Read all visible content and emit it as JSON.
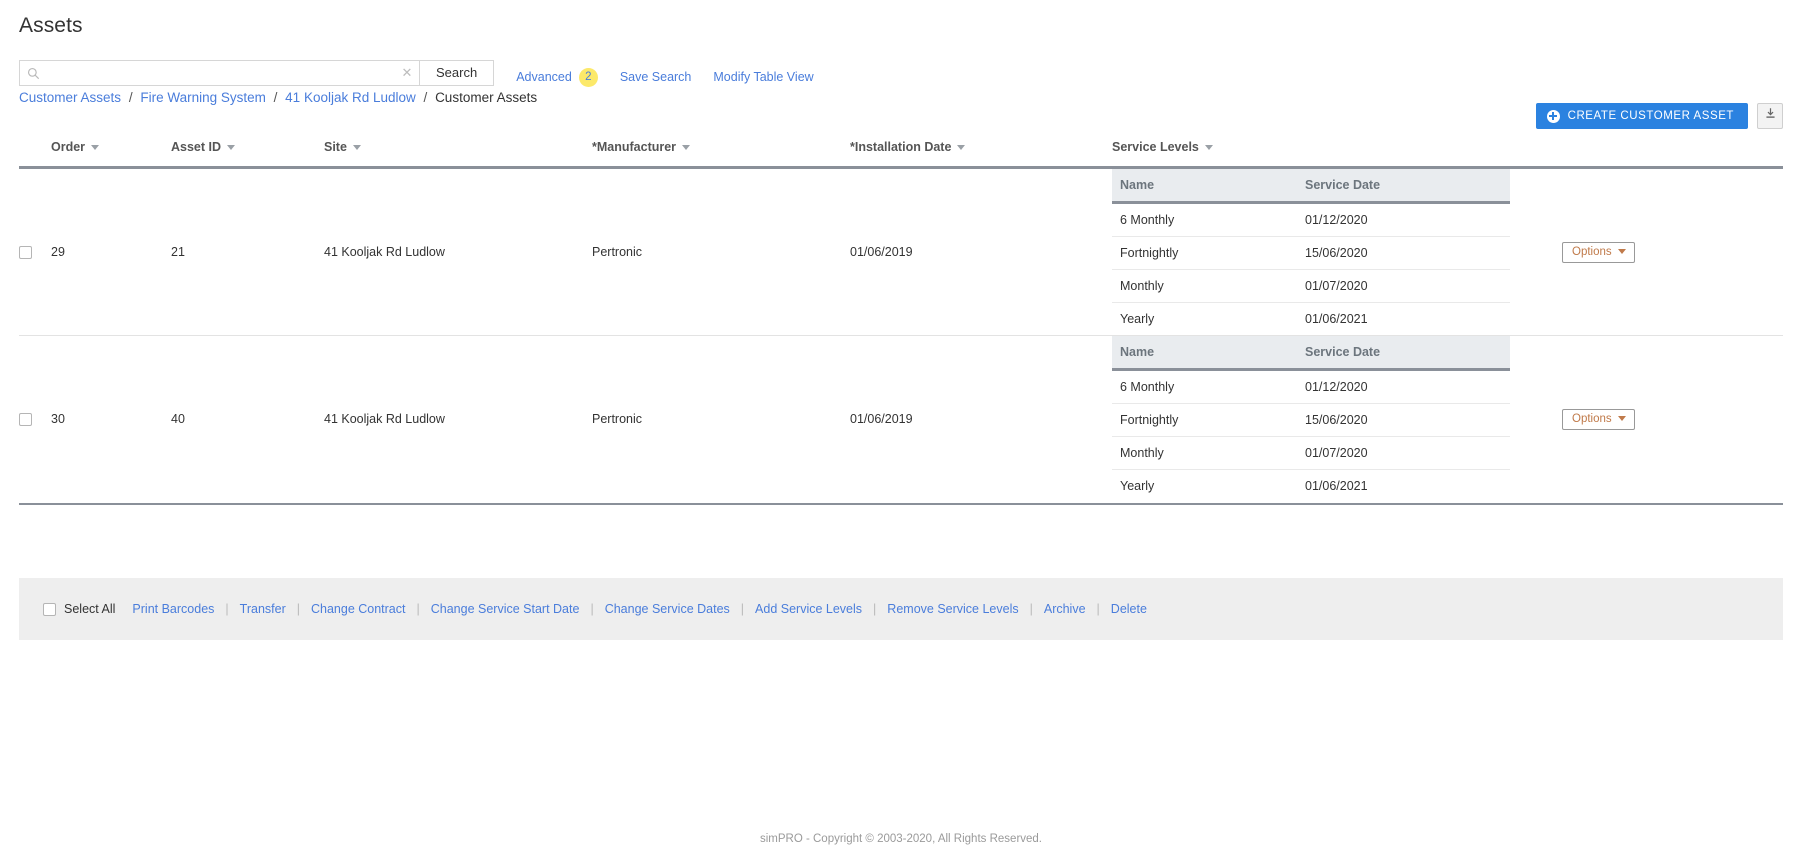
{
  "page": {
    "title": "Assets"
  },
  "search": {
    "value": "",
    "placeholder": "",
    "search_button": "Search",
    "clear_icon": "close-icon",
    "magnifier_icon": "search-icon",
    "links": {
      "advanced": "Advanced",
      "advanced_count": "2",
      "save_search": "Save Search",
      "modify_table_view": "Modify Table View"
    }
  },
  "breadcrumb": {
    "items": [
      {
        "label": "Customer Assets",
        "link": true
      },
      {
        "label": "Fire Warning System",
        "link": true
      },
      {
        "label": "41 Kooljak Rd Ludlow",
        "link": true
      },
      {
        "label": "Customer Assets",
        "link": false
      }
    ],
    "separator": "/"
  },
  "top_actions": {
    "create_label": "CREATE CUSTOMER ASSET",
    "create_icon": "plus-circle-icon",
    "export_icon": "download-icon"
  },
  "table": {
    "columns": [
      {
        "label": "Order",
        "sortable": true
      },
      {
        "label": "Asset ID",
        "sortable": true
      },
      {
        "label": "Site",
        "sortable": true
      },
      {
        "label": "*Manufacturer",
        "sortable": true
      },
      {
        "label": "*Installation Date",
        "sortable": true
      },
      {
        "label": "Service Levels",
        "sortable": true
      }
    ],
    "service_columns": [
      "Name",
      "Service Date"
    ],
    "options_label": "Options",
    "rows": [
      {
        "selected": false,
        "order": "29",
        "asset_id": "21",
        "site": "41 Kooljak Rd Ludlow",
        "manufacturer": "Pertronic",
        "installation_date": "01/06/2019",
        "service_levels": [
          {
            "name": "6 Monthly",
            "service_date": "01/12/2020"
          },
          {
            "name": "Fortnightly",
            "service_date": "15/06/2020"
          },
          {
            "name": "Monthly",
            "service_date": "01/07/2020"
          },
          {
            "name": "Yearly",
            "service_date": "01/06/2021"
          }
        ]
      },
      {
        "selected": false,
        "order": "30",
        "asset_id": "40",
        "site": "41 Kooljak Rd Ludlow",
        "manufacturer": "Pertronic",
        "installation_date": "01/06/2019",
        "service_levels": [
          {
            "name": "6 Monthly",
            "service_date": "01/12/2020"
          },
          {
            "name": "Fortnightly",
            "service_date": "15/06/2020"
          },
          {
            "name": "Monthly",
            "service_date": "01/07/2020"
          },
          {
            "name": "Yearly",
            "service_date": "01/06/2021"
          }
        ]
      }
    ]
  },
  "action_bar": {
    "select_all": "Select All",
    "actions": [
      "Print Barcodes",
      "Transfer",
      "Change Contract",
      "Change Service Start Date",
      "Change Service Dates",
      "Add Service Levels",
      "Remove Service Levels",
      "Archive",
      "Delete"
    ],
    "separator": "|"
  },
  "footer": {
    "text": "simPRO - Copyright © 2003-2020, All Rights Reserved."
  },
  "colors": {
    "link": "#4a7ddb",
    "primary_button": "#2b82e0",
    "badge": "#fce96a",
    "header_rule": "#8a9099",
    "action_bar_bg": "#eeeeee",
    "svc_header_bg": "#e9ecef",
    "options_text": "#c07a4a"
  }
}
